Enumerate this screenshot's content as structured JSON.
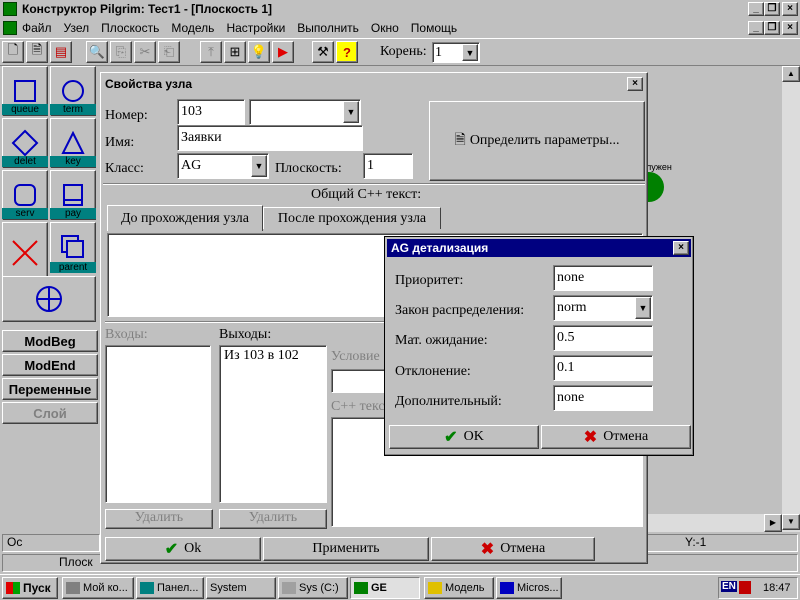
{
  "app": {
    "title": "Конструктор Pilgrim: Тест1 - [Плоскость 1]",
    "menu": [
      "Файл",
      "Узел",
      "Плоскость",
      "Модель",
      "Настройки",
      "Выполнить",
      "Окно",
      "Помощь"
    ],
    "root_label": "Корень:",
    "root_value": "1"
  },
  "palette": {
    "items": [
      {
        "label": "queue",
        "icon": "square-icon"
      },
      {
        "label": "term",
        "icon": "circle-icon"
      },
      {
        "label": "delet",
        "icon": "diamond-icon"
      },
      {
        "label": "key",
        "icon": "triangle-icon"
      },
      {
        "label": "serv",
        "icon": "rounded-square-icon"
      },
      {
        "label": "pay",
        "icon": "tray-icon"
      },
      {
        "label": "",
        "icon": "red-x-icon"
      },
      {
        "label": "parent",
        "icon": "stacked-squares-icon"
      }
    ],
    "buttons": [
      "ModBeg",
      "ModEnd",
      "Переменные",
      "Слой"
    ]
  },
  "canvas": {
    "node_label": "лужен",
    "status_y": "Y:-1",
    "status_left_1": "Ос",
    "status_left_2": "Плоск"
  },
  "node_props": {
    "title": "Свойства узла",
    "number_label": "Номер:",
    "number_value": "103",
    "name_label": "Имя:",
    "name_value": "Заявки",
    "class_label": "Класс:",
    "class_value": "AG",
    "plane_label": "Плоскость:",
    "plane_value": "1",
    "define_params": "Определить параметры...",
    "common_cpp": "Общий C++ текст:",
    "tab_before": "До прохождения узла",
    "tab_after": "После прохождения узла",
    "inputs_label": "Входы:",
    "outputs_label": "Выходы:",
    "outputs_items": [
      "Из 103 в 102"
    ],
    "condition_label": "Условие",
    "cpp_label": "C++ текст",
    "delete_inputs": "Удалить",
    "delete_outputs": "Удалить",
    "ok": "Ok",
    "apply": "Применить",
    "cancel": "Отмена"
  },
  "ag_dialog": {
    "title": "AG детализация",
    "priority_label": "Приоритет:",
    "priority_value": "none",
    "law_label": "Закон распределения:",
    "law_value": "norm",
    "mean_label": "Мат. ожидание:",
    "mean_value": "0.5",
    "dev_label": "Отклонение:",
    "dev_value": "0.1",
    "extra_label": "Дополнительный:",
    "extra_value": "none",
    "ok": "OK",
    "cancel": "Отмена"
  },
  "taskbar": {
    "start": "Пуск",
    "tasks": [
      "Мой ко...",
      "Панел...",
      "System",
      "Sys (C:)",
      "GE",
      "Модель",
      "Micros..."
    ],
    "lang": "EN",
    "clock": "18:47"
  },
  "colors": {
    "teal": "#008080",
    "title_blue": "#000080",
    "green_check": "#008000",
    "red_cross": "#cc0000"
  }
}
